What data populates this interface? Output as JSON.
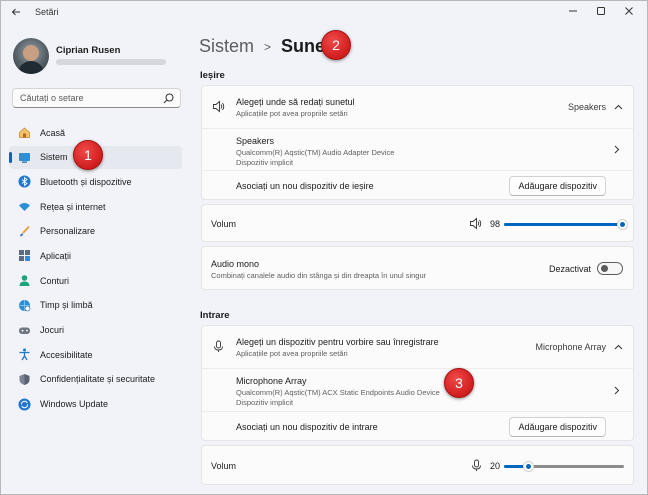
{
  "window": {
    "title": "Setări",
    "controls": [
      "minimize",
      "maximize",
      "close"
    ]
  },
  "user": {
    "name": "Ciprian Rusen"
  },
  "search": {
    "placeholder": "Căutați o setare"
  },
  "sidebar": {
    "items": [
      {
        "label": "Acasă",
        "icon": "home-icon",
        "active": false
      },
      {
        "label": "Sistem",
        "icon": "system-icon",
        "active": true
      },
      {
        "label": "Bluetooth și dispozitive",
        "icon": "bluetooth-icon",
        "active": false
      },
      {
        "label": "Rețea și internet",
        "icon": "wifi-icon",
        "active": false
      },
      {
        "label": "Personalizare",
        "icon": "brush-icon",
        "active": false
      },
      {
        "label": "Aplicații",
        "icon": "apps-icon",
        "active": false
      },
      {
        "label": "Conturi",
        "icon": "account-icon",
        "active": false
      },
      {
        "label": "Timp și limbă",
        "icon": "globe-clock-icon",
        "active": false
      },
      {
        "label": "Jocuri",
        "icon": "gamepad-icon",
        "active": false
      },
      {
        "label": "Accesibilitate",
        "icon": "accessibility-icon",
        "active": false
      },
      {
        "label": "Confidențialitate și securitate",
        "icon": "shield-icon",
        "active": false
      },
      {
        "label": "Windows Update",
        "icon": "update-icon",
        "active": false
      }
    ]
  },
  "breadcrumb": {
    "parent": "Sistem",
    "separator": ">",
    "current": "Sunet"
  },
  "output": {
    "section_title": "Ieșire",
    "choose": {
      "title": "Alegeți unde să redați sunetul",
      "subtitle": "Aplicațiile pot avea propriile setări",
      "value": "Speakers"
    },
    "device": {
      "name": "Speakers",
      "detail": "Qualcomm(R) Aqstic(TM) Audio Adapter Device",
      "status": "Dispozitiv implicit"
    },
    "pair": {
      "label": "Asociați un nou dispozitiv de ieșire",
      "button": "Adăugare dispozitiv"
    },
    "volume": {
      "label": "Volum",
      "value": "98",
      "level": 0.98
    },
    "mono": {
      "title": "Audio mono",
      "subtitle": "Combinați canalele audio din stânga și din dreapta în unul singur",
      "state": "Dezactivat",
      "on": false
    }
  },
  "input": {
    "section_title": "Intrare",
    "choose": {
      "title": "Alegeți un dispozitiv pentru vorbire sau înregistrare",
      "subtitle": "Aplicațiile pot avea propriile setări",
      "value": "Microphone Array"
    },
    "device": {
      "name": "Microphone Array",
      "detail": "Qualcomm(R) Aqstic(TM) ACX Static Endpoints Audio Device",
      "status": "Dispozitiv implicit"
    },
    "pair": {
      "label": "Asociați un nou dispozitiv de intrare",
      "button": "Adăugare dispozitiv"
    },
    "volume": {
      "label": "Volum",
      "value": "20",
      "level": 0.2
    }
  },
  "markers": [
    "1",
    "2",
    "3"
  ],
  "colors": {
    "accent": "#0067c0",
    "marker": "#d01d1d",
    "background": "#f1f3f9",
    "card": "#fbfbfc"
  }
}
